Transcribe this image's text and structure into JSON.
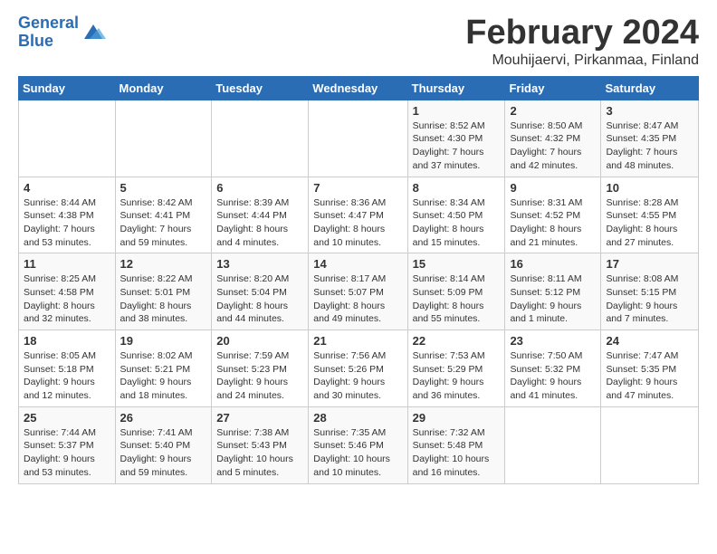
{
  "logo": {
    "line1": "General",
    "line2": "Blue"
  },
  "title": "February 2024",
  "subtitle": "Mouhijaervi, Pirkanmaa, Finland",
  "days_of_week": [
    "Sunday",
    "Monday",
    "Tuesday",
    "Wednesday",
    "Thursday",
    "Friday",
    "Saturday"
  ],
  "weeks": [
    [
      {
        "day": "",
        "info": ""
      },
      {
        "day": "",
        "info": ""
      },
      {
        "day": "",
        "info": ""
      },
      {
        "day": "",
        "info": ""
      },
      {
        "day": "1",
        "info": "Sunrise: 8:52 AM\nSunset: 4:30 PM\nDaylight: 7 hours and 37 minutes."
      },
      {
        "day": "2",
        "info": "Sunrise: 8:50 AM\nSunset: 4:32 PM\nDaylight: 7 hours and 42 minutes."
      },
      {
        "day": "3",
        "info": "Sunrise: 8:47 AM\nSunset: 4:35 PM\nDaylight: 7 hours and 48 minutes."
      }
    ],
    [
      {
        "day": "4",
        "info": "Sunrise: 8:44 AM\nSunset: 4:38 PM\nDaylight: 7 hours and 53 minutes."
      },
      {
        "day": "5",
        "info": "Sunrise: 8:42 AM\nSunset: 4:41 PM\nDaylight: 7 hours and 59 minutes."
      },
      {
        "day": "6",
        "info": "Sunrise: 8:39 AM\nSunset: 4:44 PM\nDaylight: 8 hours and 4 minutes."
      },
      {
        "day": "7",
        "info": "Sunrise: 8:36 AM\nSunset: 4:47 PM\nDaylight: 8 hours and 10 minutes."
      },
      {
        "day": "8",
        "info": "Sunrise: 8:34 AM\nSunset: 4:50 PM\nDaylight: 8 hours and 15 minutes."
      },
      {
        "day": "9",
        "info": "Sunrise: 8:31 AM\nSunset: 4:52 PM\nDaylight: 8 hours and 21 minutes."
      },
      {
        "day": "10",
        "info": "Sunrise: 8:28 AM\nSunset: 4:55 PM\nDaylight: 8 hours and 27 minutes."
      }
    ],
    [
      {
        "day": "11",
        "info": "Sunrise: 8:25 AM\nSunset: 4:58 PM\nDaylight: 8 hours and 32 minutes."
      },
      {
        "day": "12",
        "info": "Sunrise: 8:22 AM\nSunset: 5:01 PM\nDaylight: 8 hours and 38 minutes."
      },
      {
        "day": "13",
        "info": "Sunrise: 8:20 AM\nSunset: 5:04 PM\nDaylight: 8 hours and 44 minutes."
      },
      {
        "day": "14",
        "info": "Sunrise: 8:17 AM\nSunset: 5:07 PM\nDaylight: 8 hours and 49 minutes."
      },
      {
        "day": "15",
        "info": "Sunrise: 8:14 AM\nSunset: 5:09 PM\nDaylight: 8 hours and 55 minutes."
      },
      {
        "day": "16",
        "info": "Sunrise: 8:11 AM\nSunset: 5:12 PM\nDaylight: 9 hours and 1 minute."
      },
      {
        "day": "17",
        "info": "Sunrise: 8:08 AM\nSunset: 5:15 PM\nDaylight: 9 hours and 7 minutes."
      }
    ],
    [
      {
        "day": "18",
        "info": "Sunrise: 8:05 AM\nSunset: 5:18 PM\nDaylight: 9 hours and 12 minutes."
      },
      {
        "day": "19",
        "info": "Sunrise: 8:02 AM\nSunset: 5:21 PM\nDaylight: 9 hours and 18 minutes."
      },
      {
        "day": "20",
        "info": "Sunrise: 7:59 AM\nSunset: 5:23 PM\nDaylight: 9 hours and 24 minutes."
      },
      {
        "day": "21",
        "info": "Sunrise: 7:56 AM\nSunset: 5:26 PM\nDaylight: 9 hours and 30 minutes."
      },
      {
        "day": "22",
        "info": "Sunrise: 7:53 AM\nSunset: 5:29 PM\nDaylight: 9 hours and 36 minutes."
      },
      {
        "day": "23",
        "info": "Sunrise: 7:50 AM\nSunset: 5:32 PM\nDaylight: 9 hours and 41 minutes."
      },
      {
        "day": "24",
        "info": "Sunrise: 7:47 AM\nSunset: 5:35 PM\nDaylight: 9 hours and 47 minutes."
      }
    ],
    [
      {
        "day": "25",
        "info": "Sunrise: 7:44 AM\nSunset: 5:37 PM\nDaylight: 9 hours and 53 minutes."
      },
      {
        "day": "26",
        "info": "Sunrise: 7:41 AM\nSunset: 5:40 PM\nDaylight: 9 hours and 59 minutes."
      },
      {
        "day": "27",
        "info": "Sunrise: 7:38 AM\nSunset: 5:43 PM\nDaylight: 10 hours and 5 minutes."
      },
      {
        "day": "28",
        "info": "Sunrise: 7:35 AM\nSunset: 5:46 PM\nDaylight: 10 hours and 10 minutes."
      },
      {
        "day": "29",
        "info": "Sunrise: 7:32 AM\nSunset: 5:48 PM\nDaylight: 10 hours and 16 minutes."
      },
      {
        "day": "",
        "info": ""
      },
      {
        "day": "",
        "info": ""
      }
    ]
  ]
}
